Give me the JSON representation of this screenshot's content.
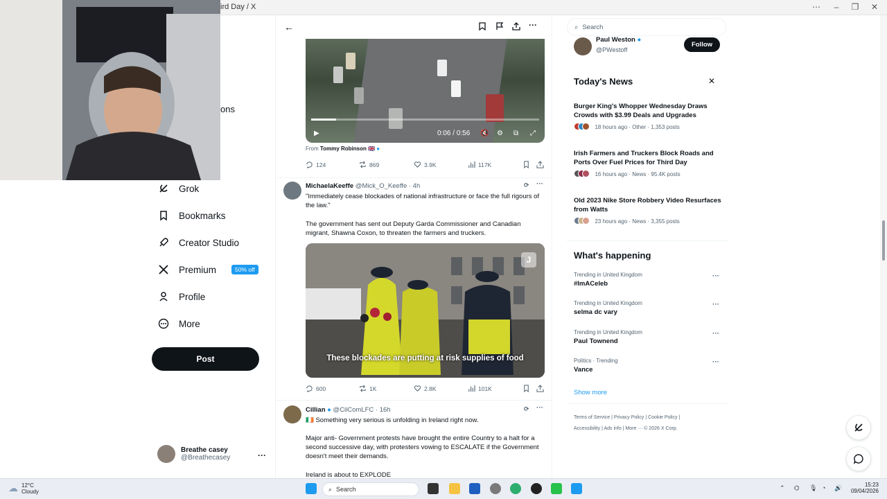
{
  "window": {
    "title": "ird Day / X"
  },
  "sidebar": {
    "partial_text": "ons",
    "items": [
      {
        "label": "Grok"
      },
      {
        "label": "Bookmarks"
      },
      {
        "label": "Creator Studio"
      },
      {
        "label": "Premium",
        "badge": "50% off"
      },
      {
        "label": "Profile"
      },
      {
        "label": "More"
      }
    ],
    "post_label": "Post",
    "account": {
      "name": "Breathe casey",
      "handle": "@Breathecasey",
      "more": "···"
    }
  },
  "feed": {
    "tweet1": {
      "video_time": "0:06 / 0:56",
      "video_progress": 0.11,
      "from_prefix": "From",
      "from_name": "Tommy Robinson 🇬🇧",
      "replies": "124",
      "retweets": "869",
      "likes": "3.9K",
      "views": "117K"
    },
    "tweet2": {
      "name": "MichaelaKeeffe",
      "handle": "@Mick_O_Keeffe · 4h",
      "line1": "\"Immediately cease blockades of national infrastructure or face the full rigours of the law.\"",
      "line2": "The government has sent out Deputy Garda Commissioner and Canadian migrant, Shawna Coxon, to threaten the farmers and truckers.",
      "subtitle": "These blockades are putting at risk supplies of food",
      "watermark": "J",
      "replies": "600",
      "retweets": "1K",
      "likes": "2.8K",
      "views": "101K"
    },
    "tweet3": {
      "name": "Cillian",
      "handle": "@CilComLFC · 16h",
      "line1": "🇮🇪 Something very serious is unfolding in Ireland right now.",
      "line2": "Major anti- Government protests have brought the entire Country to a halt for a second successive day, with protesters vowing to ESCALATE if the Government doesn't meet their demands.",
      "line3": "Ireland is about to EXPLODE"
    }
  },
  "right": {
    "search_placeholder": "Search",
    "who_to_follow": {
      "name": "Paul Weston",
      "handle": "@PWestoff",
      "follow": "Follow"
    },
    "news_title": "Today's News",
    "news": [
      {
        "headline": "Burger King's Whopper Wednesday Draws Crowds with $3.99 Deals and Upgrades",
        "meta": "18 hours ago · Other · 1,353 posts"
      },
      {
        "headline": "Irish Farmers and Truckers Block Roads and Ports Over Fuel Prices for Third Day",
        "meta": "16 hours ago · News · 95.4K posts"
      },
      {
        "headline": "Old 2023 Nike Store Robbery Video Resurfaces from Watts",
        "meta": "23 hours ago · News · 3,355 posts"
      }
    ],
    "happening_title": "What's happening",
    "trends": [
      {
        "context": "Trending in United Kingdom",
        "name": "#ImACeleb"
      },
      {
        "context": "Trending in United Kingdom",
        "name": "selma dc vary"
      },
      {
        "context": "Trending in United Kingdom",
        "name": "Paul Townend"
      },
      {
        "context": "Politics · Trending",
        "name": "Vance"
      }
    ],
    "show_more": "Show more",
    "footer_line1": "Terms of Service  |  Privacy Policy  |  Cookie Policy  |",
    "footer_line2": "Accessibility  |  Ads info  |  More ···   © 2026 X Corp."
  },
  "taskbar": {
    "temp": "12°C",
    "weather": "Cloudy",
    "search": "Search",
    "time": "15:23",
    "date": "09/04/2026"
  },
  "colors": {
    "accent": "#1d9bf0",
    "text": "#0f1419",
    "muted": "#536471"
  }
}
